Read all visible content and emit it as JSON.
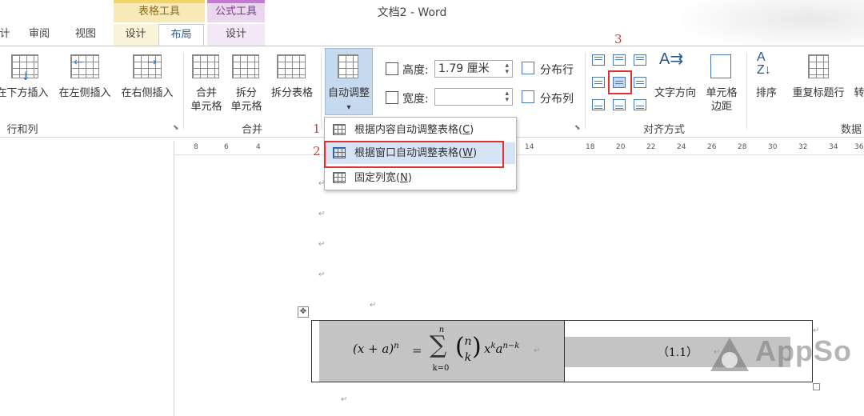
{
  "title_bar": {
    "document_title": "文档2 - Word",
    "context_table_tools": "表格工具",
    "context_formula_tools": "公式工具"
  },
  "tabs": {
    "partial_left": "计",
    "review": "审阅",
    "view": "视图",
    "table_design": "设计",
    "table_layout": "布局",
    "formula_design": "设计"
  },
  "ribbon": {
    "rows_cols": {
      "insert_below": "在下方插入",
      "insert_left": "在左侧插入",
      "insert_right": "在右侧插入",
      "group_label": "行和列"
    },
    "merge": {
      "merge_cells_line1": "合并",
      "merge_cells_line2": "单元格",
      "split_cells_line1": "拆分",
      "split_cells_line2": "单元格",
      "split_table": "拆分表格",
      "group_label": "合并"
    },
    "cell_size": {
      "autofit": "自动调整",
      "autofit_arrow": "▾",
      "height_label": "高度:",
      "height_value": "1.79 厘米",
      "width_label": "宽度:",
      "width_value": "",
      "distribute_rows": "分布行",
      "distribute_cols": "分布列"
    },
    "alignment": {
      "text_direction": "文字方向",
      "cell_margins_line1": "单元格",
      "cell_margins_line2": "边距",
      "group_label": "对齐方式"
    },
    "data": {
      "sort": "排序",
      "repeat_header": "重复标题行",
      "convert_partial": "转",
      "group_label": "数据"
    }
  },
  "annotations": {
    "step1": "1",
    "step2": "2",
    "step3": "3"
  },
  "ruler": {
    "left_ticks": [
      "8",
      "6",
      "4"
    ],
    "right_ticks": [
      "14",
      "18",
      "20",
      "22",
      "24",
      "26",
      "28",
      "30",
      "32",
      "34",
      "36"
    ]
  },
  "dropdown": {
    "item1_text": "根据内容自动调整表格(",
    "item1_key": "C",
    "item2_text": "根据窗口自动调整表格(",
    "item2_key": "W",
    "item3_text": "固定列宽(",
    "item3_key": "N",
    "close_paren": ")"
  },
  "document": {
    "paragraph_mark": "↵",
    "equation_number": "（1.1）",
    "equation": {
      "lhs": "(x + a)",
      "lhs_exp": "n",
      "equals": "=",
      "sum_upper": "n",
      "sum_lower": "k=0",
      "binom_top": "n",
      "binom_bottom": "k",
      "x": "x",
      "x_exp": "k",
      "a": "a",
      "a_exp": "n−k"
    },
    "move_handle": "✥"
  },
  "watermark": {
    "text": "AppSo"
  },
  "colors": {
    "accent": "#2b5797",
    "highlight_red": "#e03030",
    "menu_hover": "#d5e3f4",
    "cell_shading": "#c4c4c4"
  }
}
